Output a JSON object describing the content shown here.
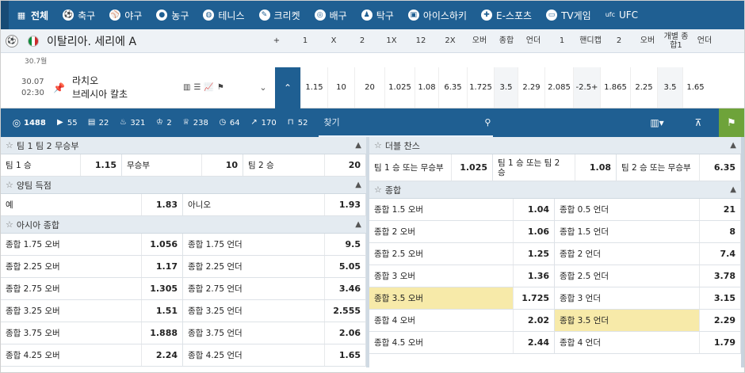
{
  "topnav": {
    "items": [
      {
        "icon": "grid-icon",
        "label": "전체",
        "active": true
      },
      {
        "icon": "soccer-icon",
        "label": "축구"
      },
      {
        "icon": "baseball-icon",
        "label": "야구"
      },
      {
        "icon": "basketball-icon",
        "label": "농구"
      },
      {
        "icon": "tennis-icon",
        "label": "테니스"
      },
      {
        "icon": "cricket-icon",
        "label": "크리켓"
      },
      {
        "icon": "volleyball-icon",
        "label": "배구"
      },
      {
        "icon": "table-tennis-icon",
        "label": "탁구"
      },
      {
        "icon": "ice-hockey-icon",
        "label": "아이스하키"
      },
      {
        "icon": "gamepad-icon",
        "label": "E-스포츠"
      },
      {
        "icon": "tv-icon",
        "label": "TV게임"
      },
      {
        "icon": "ufc-icon",
        "label": "UFC"
      }
    ],
    "ufc_badge": "ufc"
  },
  "league": {
    "name": "이탈리아. 세리에 A",
    "headers": [
      {
        "label": "+",
        "w": 36
      },
      {
        "label": "1",
        "w": 36
      },
      {
        "label": "X",
        "w": 36
      },
      {
        "label": "2",
        "w": 36
      },
      {
        "label": "1X",
        "w": 38
      },
      {
        "label": "12",
        "w": 36
      },
      {
        "label": "2X",
        "w": 38
      },
      {
        "label": "오버",
        "w": 36
      },
      {
        "label": "종합",
        "w": 32
      },
      {
        "label": "언더",
        "w": 36
      },
      {
        "label": "1",
        "w": 36
      },
      {
        "label": "핸디캡",
        "w": 36
      },
      {
        "label": "2",
        "w": 36
      },
      {
        "label": "오버",
        "w": 36
      },
      {
        "label": "개별 종합1",
        "w": 36
      },
      {
        "label": "언더",
        "w": 36
      }
    ]
  },
  "dateline": "30.7월",
  "match": {
    "date": "30.07",
    "time": "02:30",
    "team1": "라치오",
    "team2": "브레시아 칼초",
    "odds": [
      {
        "v": "1.15",
        "w": 34
      },
      {
        "v": "10",
        "w": 34
      },
      {
        "v": "20",
        "w": 38
      },
      {
        "v": "1.025",
        "w": 38
      },
      {
        "v": "1.08",
        "w": 30
      },
      {
        "v": "6.35",
        "w": 36
      },
      {
        "v": "1.725",
        "w": 34
      },
      {
        "v": "3.5",
        "w": 30,
        "alt": true
      },
      {
        "v": "2.29",
        "w": 34
      },
      {
        "v": "2.085",
        "w": 36
      },
      {
        "v": "-2.5+",
        "w": 34,
        "alt": true
      },
      {
        "v": "1.865",
        "w": 38
      },
      {
        "v": "2.25",
        "w": 34
      },
      {
        "v": "3.5",
        "w": 32,
        "alt": true
      },
      {
        "v": "1.65",
        "w": 32
      }
    ]
  },
  "toolbar": {
    "stats": [
      {
        "icon": "target-icon",
        "count": "1488"
      },
      {
        "icon": "live-icon",
        "count": "55"
      },
      {
        "icon": "chart-icon",
        "count": "22"
      },
      {
        "icon": "fire-icon",
        "count": "321"
      },
      {
        "icon": "shirt-icon",
        "count": "2"
      },
      {
        "icon": "trophy-icon",
        "count": "238"
      },
      {
        "icon": "clock-icon",
        "count": "64"
      },
      {
        "icon": "arrow-icon",
        "count": "170"
      },
      {
        "icon": "bench-icon",
        "count": "52"
      }
    ],
    "search_placeholder": "찾기"
  },
  "markets_left": [
    {
      "title": "팀 1 팀 2 무승부",
      "rows": [
        [
          {
            "label": "팀 1 승",
            "odd": "1.15"
          },
          {
            "label": "무승부",
            "odd": "10"
          },
          {
            "label": "팀 2 승",
            "odd": "20"
          }
        ]
      ]
    },
    {
      "title": "양팀 득점",
      "rows": [
        [
          {
            "label": "예",
            "odd": "1.83"
          },
          {
            "label": "아니오",
            "odd": "1.93"
          }
        ]
      ]
    },
    {
      "title": "아시아 종합",
      "rows": [
        [
          {
            "label": "종합 1.75 오버",
            "odd": "1.056"
          },
          {
            "label": "종합 1.75 언더",
            "odd": "9.5"
          }
        ],
        [
          {
            "label": "종합 2.25 오버",
            "odd": "1.17"
          },
          {
            "label": "종합 2.25 언더",
            "odd": "5.05"
          }
        ],
        [
          {
            "label": "종합 2.75 오버",
            "odd": "1.305"
          },
          {
            "label": "종합 2.75 언더",
            "odd": "3.46"
          }
        ],
        [
          {
            "label": "종합 3.25 오버",
            "odd": "1.51"
          },
          {
            "label": "종합 3.25 언더",
            "odd": "2.555"
          }
        ],
        [
          {
            "label": "종합 3.75 오버",
            "odd": "1.888"
          },
          {
            "label": "종합 3.75 언더",
            "odd": "2.06"
          }
        ],
        [
          {
            "label": "종합 4.25 오버",
            "odd": "2.24"
          },
          {
            "label": "종합 4.25 언더",
            "odd": "1.65"
          }
        ]
      ]
    }
  ],
  "markets_right": [
    {
      "title": "더블 찬스",
      "tall": true,
      "rows": [
        [
          {
            "label": "팀 1 승 또는 무승부",
            "odd": "1.025"
          },
          {
            "label": "팀 1 승 또는 팀 2 승",
            "odd": "1.08"
          },
          {
            "label": "팀 2 승 또는 무승부",
            "odd": "6.35"
          }
        ]
      ]
    },
    {
      "title": "종합",
      "rows": [
        [
          {
            "label": "종합 1.5 오버",
            "odd": "1.04"
          },
          {
            "label": "종합 0.5 언더",
            "odd": "21"
          }
        ],
        [
          {
            "label": "종합 2 오버",
            "odd": "1.06"
          },
          {
            "label": "종합 1.5 언더",
            "odd": "8"
          }
        ],
        [
          {
            "label": "종합 2.5 오버",
            "odd": "1.25"
          },
          {
            "label": "종합 2 언더",
            "odd": "7.4"
          }
        ],
        [
          {
            "label": "종합 3 오버",
            "odd": "1.36"
          },
          {
            "label": "종합 2.5 언더",
            "odd": "3.78"
          }
        ],
        [
          {
            "label": "종합 3.5 오버",
            "odd": "1.725",
            "highlight": true
          },
          {
            "label": "종합 3 언더",
            "odd": "3.15"
          }
        ],
        [
          {
            "label": "종합 4 오버",
            "odd": "2.02"
          },
          {
            "label": "종합 3.5 언더",
            "odd": "2.29",
            "highlight": true
          }
        ],
        [
          {
            "label": "종합 4.5 오버",
            "odd": "2.44"
          },
          {
            "label": "종합 4 언더",
            "odd": "1.79"
          }
        ]
      ]
    }
  ]
}
